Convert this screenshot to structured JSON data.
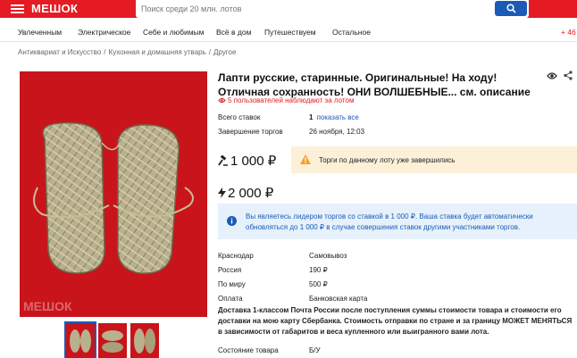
{
  "header": {
    "logo": "МЕШОК",
    "search_placeholder": "Поиск среди 20 млн. лотов"
  },
  "nav": {
    "items": [
      "Увлеченным",
      "Электрическое",
      "Себе и любимым",
      "Всё в дом",
      "Путешествуем",
      "Остальное"
    ],
    "more": "+ 46"
  },
  "breadcrumb": [
    "Антиквариат и Искусство",
    "Кухонная и домашняя утварь",
    "Другое"
  ],
  "lot": {
    "title": "Лапти русские, старинные. Оригинальные! На ходу! Отличная сохранность! ОНИ ВОЛШЕБНЫЕ... см. описание",
    "watchers": "5 пользователей наблюдают за лотом",
    "bids_label": "Всего ставок",
    "bids_count": "1",
    "show_all": "показать все",
    "end_label": "Завершение торгов",
    "end_value": "26 ноября, 12:03",
    "current_price": "1 000 ₽",
    "buy_now_price": "2 000 ₽",
    "ended_notice": "Торги по данному лоту уже завершились",
    "leader_notice": "Вы являетесь лидером торгов со ставкой в 1 000 ₽. Ваша ставка будет автоматически обновляться до 1 000 ₽ в случае совершения ставок другими участниками торгов.",
    "watermark": "МЕШОК"
  },
  "shipping": {
    "rows": [
      {
        "label": "Краснодар",
        "value": "Самовывоз"
      },
      {
        "label": "Россия",
        "value": "190 ₽"
      },
      {
        "label": "По миру",
        "value": "500 ₽"
      },
      {
        "label": "Оплата",
        "value": "Банковская карта"
      }
    ],
    "description": "Доставка 1-классом Почта России после поступления суммы стоимости товара и стоимости его доставки на мою карту Сбербанка. Стоимость отправки по стране и за границу МОЖЕТ МЕНЯТЬСЯ в зависимости от габаритов и веса купленного или выигранного вами лота."
  },
  "condition": {
    "label": "Состояние товара",
    "value": "Б/У"
  },
  "colors": {
    "brand": "#e41b23",
    "link": "#1b5bb7",
    "warning_bg": "#fdf0d9",
    "info_bg": "#e6f1fb"
  }
}
